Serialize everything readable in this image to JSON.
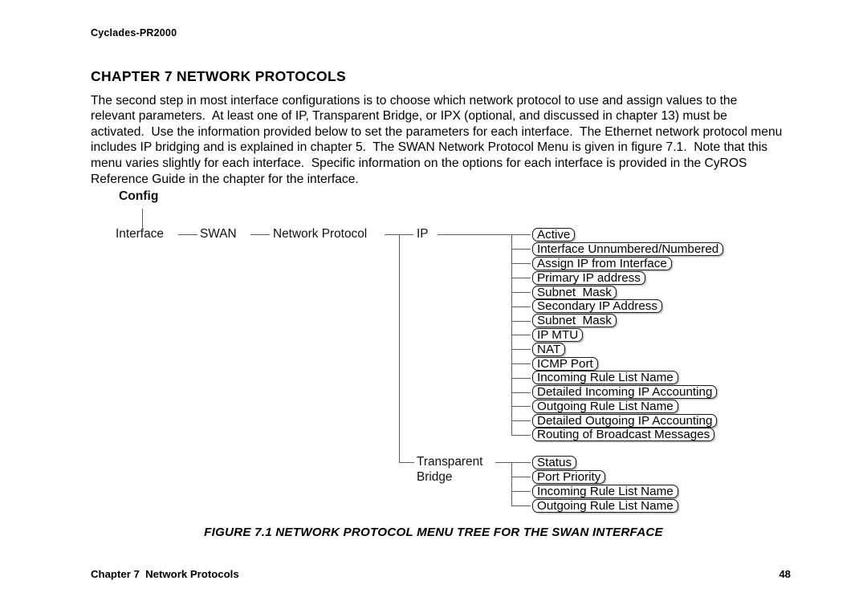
{
  "page": {
    "running_head": "Cyclades-PR2000",
    "chapter_title": "CHAPTER 7  NETWORK PROTOCOLS",
    "body_paragraph": "The second step in most interface configurations is to choose which network protocol to use and assign values to the relevant parameters.  At least one of IP, Transparent Bridge, or IPX (optional, and discussed in chapter 13) must be activated.  Use the information provided below to set the parameters for each interface.  The Ethernet network protocol menu includes IP bridging and is explained in chapter 5.  The SWAN Network Protocol Menu is given in figure 7.1.  Note that this menu varies slightly for each interface.  Specific information on the options for each interface is provided in the CyROS Reference Guide in the chapter for the interface.",
    "figure_caption": "FIGURE 7.1 NETWORK PROTOCOL MENU TREE FOR THE SWAN INTERFACE",
    "footer_left": "Chapter 7  Network Protocols",
    "footer_page_number": "48"
  },
  "figure": {
    "root_label": "Config",
    "path_nodes": [
      {
        "label": "Interface"
      },
      {
        "label": "SWAN"
      },
      {
        "label": "Network Protocol"
      }
    ],
    "branches": [
      {
        "label": "IP",
        "leaves": [
          {
            "label": "Active"
          },
          {
            "label": "Interface Unnumbered/Numbered"
          },
          {
            "label": "Assign IP from Interface"
          },
          {
            "label": "Primary IP address"
          },
          {
            "label": "Subnet  Mask"
          },
          {
            "label": "Secondary IP Address"
          },
          {
            "label": "Subnet  Mask"
          },
          {
            "label": "IP MTU"
          },
          {
            "label": "NAT"
          },
          {
            "label": "ICMP Port"
          },
          {
            "label": "Incoming Rule List Name"
          },
          {
            "label": "Detailed Incoming IP Accounting"
          },
          {
            "label": "Outgoing Rule List Name"
          },
          {
            "label": "Detailed Outgoing IP Accounting"
          },
          {
            "label": "Routing of Broadcast Messages"
          }
        ]
      },
      {
        "label": "Transparent\nBridge",
        "label_line1": "Transparent",
        "label_line2": "Bridge",
        "leaves": [
          {
            "label": "Status"
          },
          {
            "label": "Port Priority"
          },
          {
            "label": "Incoming Rule List Name"
          },
          {
            "label": "Outgoing Rule List Name"
          }
        ]
      }
    ],
    "colors": {
      "connector": "#5d5d5d",
      "box_border": "#1a1a1a",
      "box_shadow": "#c9c9c9",
      "text": "#000000",
      "page_background": "#ffffff"
    }
  }
}
